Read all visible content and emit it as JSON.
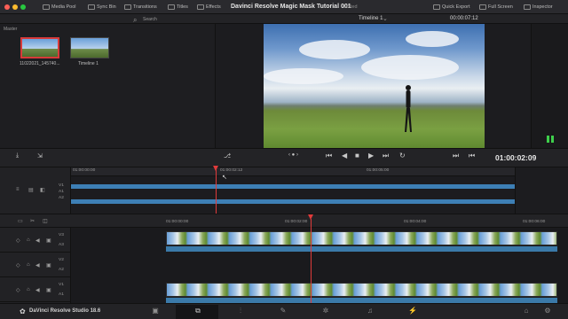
{
  "window": {
    "title": "Davinci Resolve Magic Mask Tutorial 001",
    "edited_label": "Edited"
  },
  "toolbar": {
    "media_pool": "Media Pool",
    "sync_bin": "Sync Bin",
    "transitions": "Transitions",
    "titles": "Titles",
    "effects": "Effects",
    "quick_export": "Quick Export",
    "full_screen": "Full Screen",
    "inspector": "Inspector"
  },
  "subbar": {
    "search_label": "Search",
    "timeline_name": "Timeline 1",
    "timecode": "00:00:07:12"
  },
  "media_pool": {
    "bin_name": "Master",
    "clips": [
      {
        "label": "11022021_145740..."
      },
      {
        "label": "Timeline 1"
      }
    ]
  },
  "transport": {
    "timecode": "01:00:02:09"
  },
  "upper_timeline": {
    "ticks": [
      "01:00:00:00",
      "01:00:02:12",
      "01:00:05:00"
    ],
    "track_labels": [
      "V1",
      "A1",
      "A2"
    ]
  },
  "lower_timeline": {
    "ticks": [
      "01:00:00:00",
      "01:00:02:00",
      "01:00:04:00",
      "01:00:06:00"
    ],
    "track_labels": [
      {
        "video": "V3",
        "audio": "A3"
      },
      {
        "video": "V2",
        "audio": "A2"
      },
      {
        "video": "V1",
        "audio": "A1"
      }
    ]
  },
  "status": {
    "app_name": "DaVinci Resolve Studio 18.6"
  },
  "colors": {
    "accent": "#e03b3b",
    "audio_blue": "#3d7fb5",
    "meter_green": "#3ecf4b"
  },
  "icons": [
    "media-pool-icon",
    "sync-bin-icon",
    "transitions-icon",
    "titles-icon",
    "effects-icon",
    "quick-export-icon",
    "full-screen-icon",
    "inspector-icon",
    "play-icon",
    "stop-icon",
    "loop-icon",
    "speaker-icon",
    "lock-icon",
    "resolve-logo-icon",
    "cut-page-icon",
    "edit-page-icon",
    "fusion-page-icon",
    "color-page-icon",
    "fairlight-page-icon",
    "deliver-page-icon",
    "home-icon",
    "settings-icon"
  ]
}
